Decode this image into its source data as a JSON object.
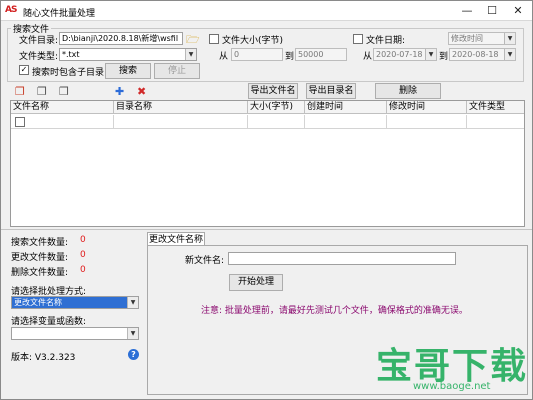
{
  "window": {
    "icon_text": "AS",
    "title": "随心文件批量处理",
    "min_label": "—",
    "max_label": "☐",
    "close_label": "✕"
  },
  "search": {
    "group_title": "搜索文件",
    "dir_label": "文件目录:",
    "dir_value": "D:\\bianji\\2020.8.18\\新增\\wsfil",
    "type_label": "文件类型:",
    "type_value": "*.txt",
    "subdir_label": "搜索时包含子目录",
    "subdir_checked": true,
    "search_button": "搜索",
    "stop_button": "停止",
    "size_label": "文件大小(字节)",
    "size_checked": false,
    "size_from_label": "从",
    "size_from": "0",
    "size_to_label": "到",
    "size_to": "50000",
    "date_label": "文件日期:",
    "date_checked": false,
    "date_mode": "修改时间",
    "date_from_label": "从",
    "date_from": "2020-07-18",
    "date_to_label": "到",
    "date_to": "2020-08-18"
  },
  "toolbar": {
    "export_names": "导出文件名",
    "export_dirs": "导出目录名",
    "delete": "删除"
  },
  "grid": {
    "columns": [
      "文件名称",
      "目录名称",
      "大小(字节)",
      "创建时间",
      "修改时间",
      "文件类型"
    ]
  },
  "stats": {
    "searched_label": "搜索文件数量:",
    "searched_value": "0",
    "changed_label": "更改文件数量:",
    "changed_value": "0",
    "deleted_label": "删除文件数量:",
    "deleted_value": "0",
    "mode_label": "请选择批处理方式:",
    "mode_value": "更改文件名称",
    "var_label": "请选择变量或函数:",
    "var_value": "",
    "version": "版本: V3.2.323",
    "help_icon": "?"
  },
  "rename": {
    "tab_label": "更改文件名称",
    "new_name_label": "新文件名:",
    "new_name_value": "",
    "start_button": "开始处理",
    "note": "注意: 批量处理前，请最好先测试几个文件，确保格式的准确无误。"
  },
  "watermark": {
    "brand": "宝哥下载",
    "url": "www.baoge.net"
  },
  "colors": {
    "accent_blue": "#2f6fd3",
    "note_purple": "#8b0a6f",
    "count_red": "#e01b1b",
    "watermark_green": "#36b36a"
  }
}
